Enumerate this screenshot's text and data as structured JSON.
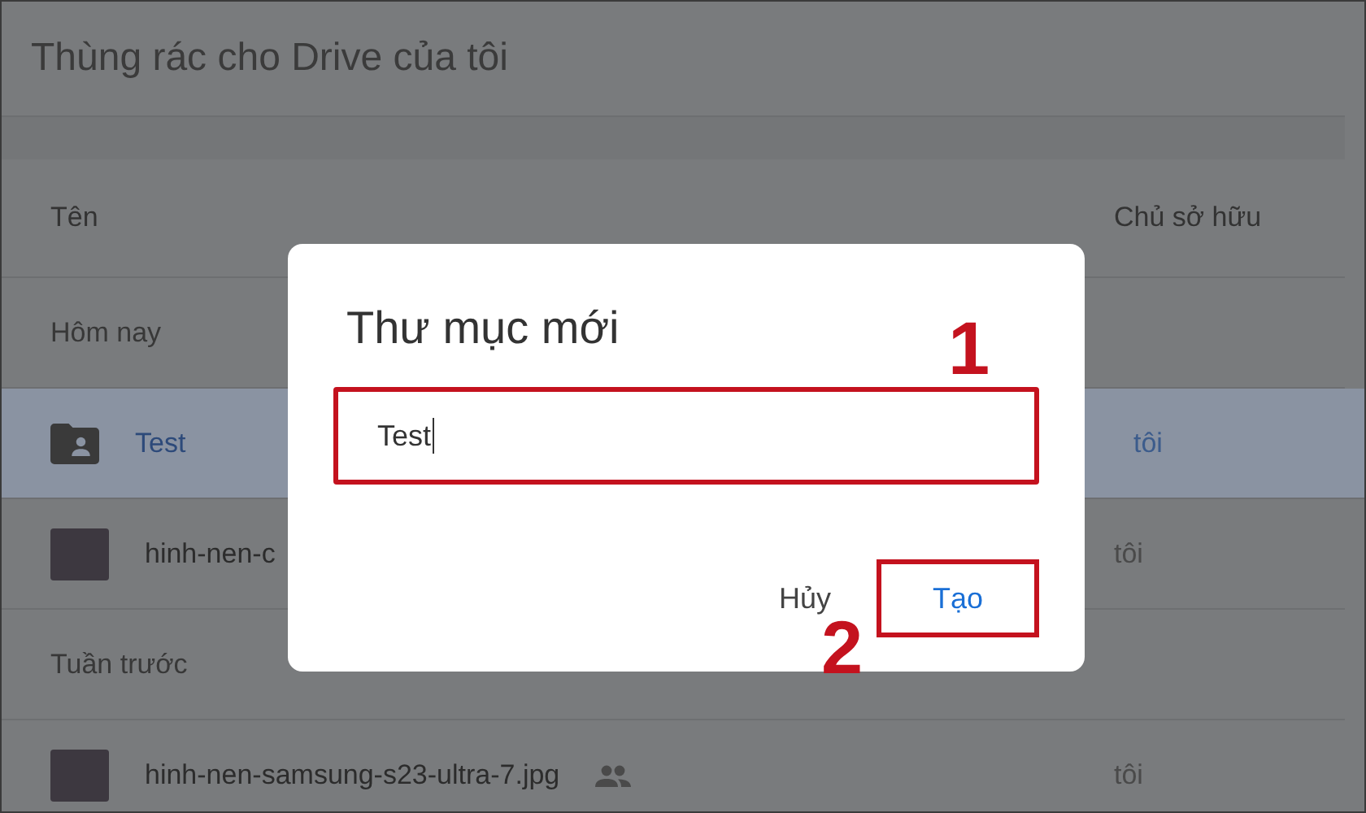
{
  "header": {
    "title": "Thùng rác cho Drive của tôi"
  },
  "table": {
    "columns": [
      "Tên",
      "Chủ sở hữu"
    ],
    "sections": [
      {
        "label": "Hôm nay",
        "rows": [
          {
            "name": "Test",
            "kind": "folder",
            "owner": "tôi",
            "shared": false,
            "selected": true
          },
          {
            "name": "hinh-nen-c",
            "kind": "image",
            "owner": "tôi",
            "shared": false,
            "selected": false
          }
        ]
      },
      {
        "label": "Tuần trước",
        "rows": [
          {
            "name": "hinh-nen-samsung-s23-ultra-7.jpg",
            "kind": "image",
            "owner": "tôi",
            "shared": true,
            "selected": false
          }
        ]
      }
    ]
  },
  "dialog": {
    "title": "Thư mục mới",
    "input": {
      "value": "Test"
    },
    "buttons": [
      {
        "label": "Hủy",
        "kind": "cancel"
      },
      {
        "label": "Tạo",
        "kind": "primary"
      }
    ]
  },
  "annotations": [
    "1",
    "2"
  ]
}
